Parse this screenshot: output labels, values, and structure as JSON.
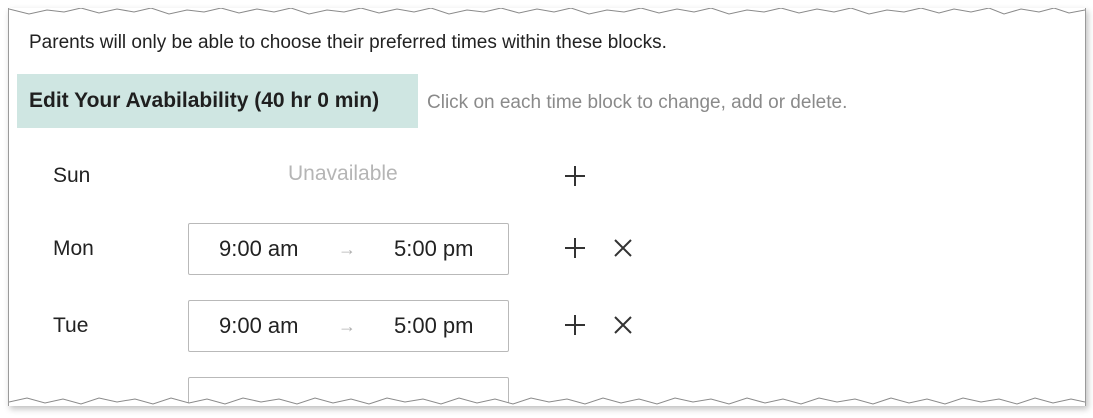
{
  "info_text": "Parents will only be able to choose their preferred times within these blocks.",
  "section": {
    "title": "Edit Your Avabilability (40 hr 0 min)",
    "hint": "Click on each time block to change, add or delete."
  },
  "colors": {
    "header_bg": "#cfe6e2",
    "unavailable_text": "#b5b5b5",
    "hint_text": "#8a8a8a"
  },
  "days": [
    {
      "day": "Sun",
      "available": false,
      "unavailable_label": "Unavailable"
    },
    {
      "day": "Mon",
      "available": true,
      "start": "9:00 am",
      "arrow": "→",
      "end": "5:00 pm"
    },
    {
      "day": "Tue",
      "available": true,
      "start": "9:00 am",
      "arrow": "→",
      "end": "5:00 pm"
    }
  ]
}
